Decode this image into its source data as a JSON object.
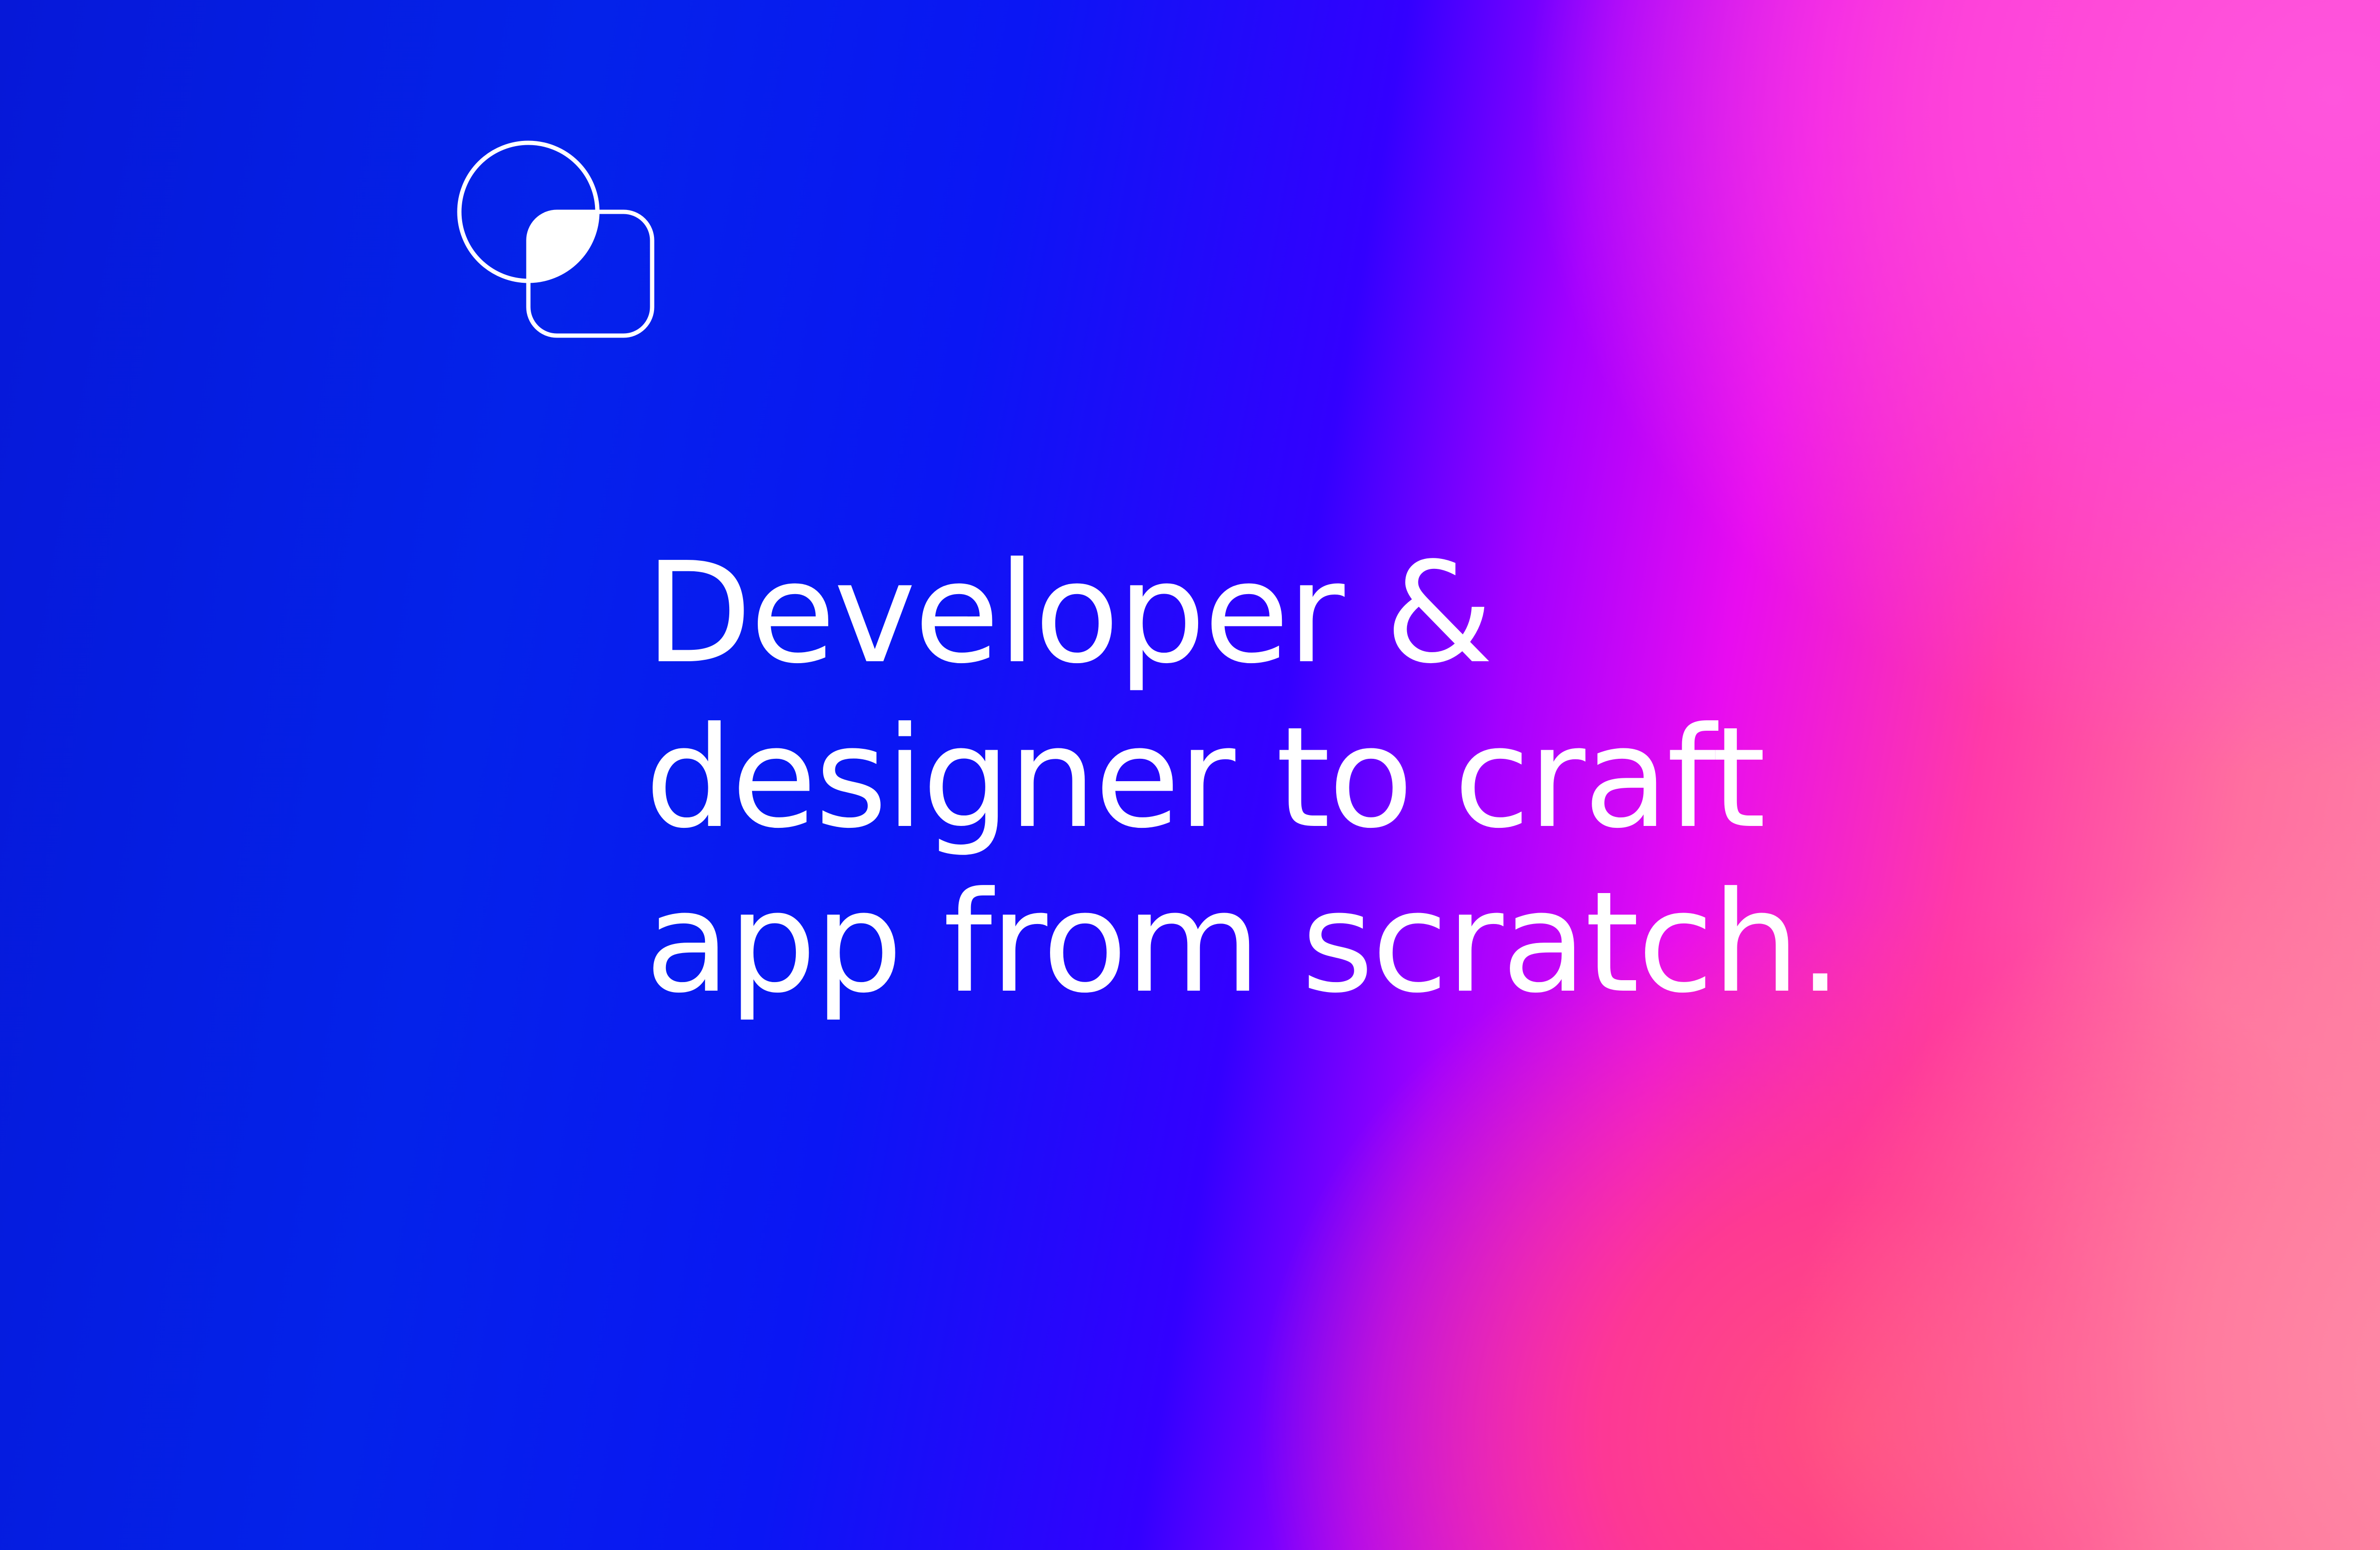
{
  "logo": {
    "icon": "circle-and-rounded-square-icon",
    "color": "#ffffff"
  },
  "headline": {
    "lines": [
      "Developer &",
      "designer to craft",
      "app from scratch."
    ]
  },
  "colors": {
    "text": "#ffffff",
    "gradient_start": "#0618d8",
    "gradient_mid": "#a300ff",
    "gradient_pink": "#ff3aa8",
    "gradient_end": "#ff88aa"
  }
}
